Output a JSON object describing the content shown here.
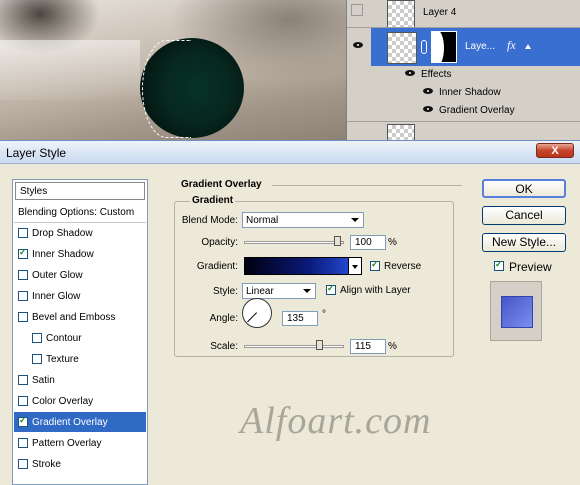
{
  "canvas": {},
  "layers_panel": {
    "layer4_name": "Layer 4",
    "active_layer_name": "Laye...",
    "fx_label": "fx",
    "effects_label": "Effects",
    "effects": [
      "Inner Shadow",
      "Gradient Overlay"
    ]
  },
  "dialog": {
    "title": "Layer Style",
    "close_label": "X"
  },
  "styles_list": {
    "header": "Styles",
    "items": [
      {
        "label": "Blending Options: Custom",
        "checkbox": false,
        "checked": false,
        "indent": false,
        "selected": false
      },
      {
        "label": "Drop Shadow",
        "checkbox": true,
        "checked": false,
        "indent": false,
        "selected": false
      },
      {
        "label": "Inner Shadow",
        "checkbox": true,
        "checked": true,
        "indent": false,
        "selected": false
      },
      {
        "label": "Outer Glow",
        "checkbox": true,
        "checked": false,
        "indent": false,
        "selected": false
      },
      {
        "label": "Inner Glow",
        "checkbox": true,
        "checked": false,
        "indent": false,
        "selected": false
      },
      {
        "label": "Bevel and Emboss",
        "checkbox": true,
        "checked": false,
        "indent": false,
        "selected": false
      },
      {
        "label": "Contour",
        "checkbox": true,
        "checked": false,
        "indent": true,
        "selected": false
      },
      {
        "label": "Texture",
        "checkbox": true,
        "checked": false,
        "indent": true,
        "selected": false
      },
      {
        "label": "Satin",
        "checkbox": true,
        "checked": false,
        "indent": false,
        "selected": false
      },
      {
        "label": "Color Overlay",
        "checkbox": true,
        "checked": false,
        "indent": false,
        "selected": false
      },
      {
        "label": "Gradient Overlay",
        "checkbox": true,
        "checked": true,
        "indent": false,
        "selected": true
      },
      {
        "label": "Pattern Overlay",
        "checkbox": true,
        "checked": false,
        "indent": false,
        "selected": false
      },
      {
        "label": "Stroke",
        "checkbox": true,
        "checked": false,
        "indent": false,
        "selected": false
      }
    ]
  },
  "gradient_overlay": {
    "section_title": "Gradient Overlay",
    "group_title": "Gradient",
    "blend_mode_label": "Blend Mode:",
    "blend_mode_value": "Normal",
    "opacity_label": "Opacity:",
    "opacity_value": "100",
    "opacity_fraction": 1.0,
    "opacity_unit": "%",
    "gradient_label": "Gradient:",
    "gradient_colors": [
      "#000010",
      "#0a1a7a",
      "#2a55e8"
    ],
    "reverse_label": "Reverse",
    "reverse_checked": true,
    "style_label": "Style:",
    "style_value": "Linear",
    "align_label": "Align with Layer",
    "align_checked": true,
    "angle_label": "Angle:",
    "angle_value": "135",
    "angle_unit": "°",
    "scale_label": "Scale:",
    "scale_value": "115",
    "scale_fraction": 0.77,
    "scale_unit": "%"
  },
  "buttons": {
    "ok": "OK",
    "cancel": "Cancel",
    "new_style": "New Style...",
    "preview_label": "Preview",
    "preview_checked": true
  },
  "watermark": "Alfoart.com"
}
